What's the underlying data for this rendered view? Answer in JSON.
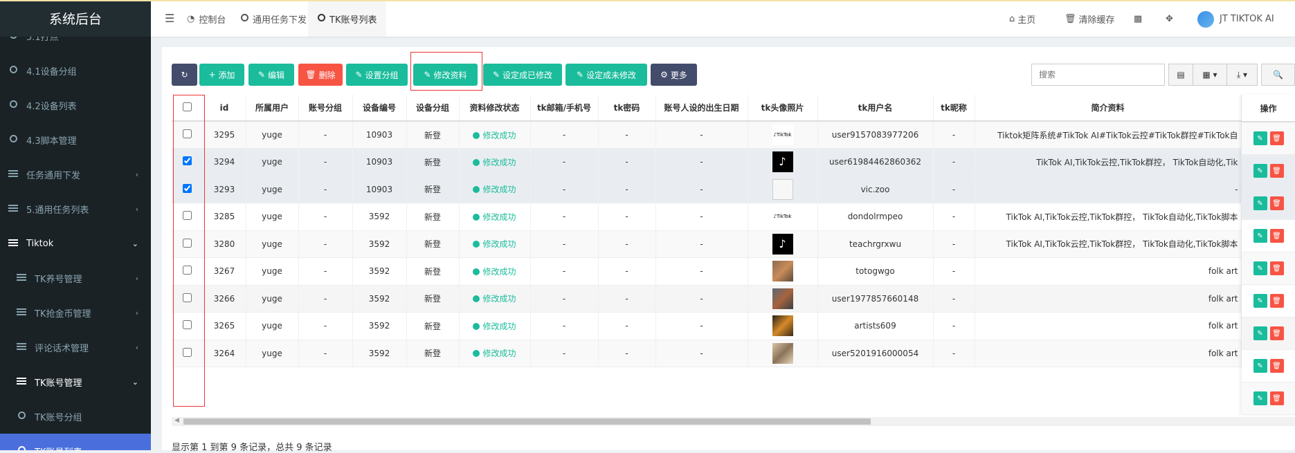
{
  "app_title": "系统后台",
  "sidebar": {
    "items": [
      {
        "label": "5.1打点",
        "icon": "circle",
        "type": "leaf"
      },
      {
        "label": "4.1设备分组",
        "icon": "circle",
        "type": "leaf"
      },
      {
        "label": "4.2设备列表",
        "icon": "circle",
        "type": "leaf"
      },
      {
        "label": "4.3脚本管理",
        "icon": "circle",
        "type": "leaf"
      },
      {
        "label": "任务通用下发",
        "icon": "list",
        "type": "group"
      },
      {
        "label": "5.通用任务列表",
        "icon": "list",
        "type": "group"
      },
      {
        "label": "Tiktok",
        "icon": "list",
        "type": "open"
      },
      {
        "label": "TK养号管理",
        "icon": "list",
        "type": "subgroup"
      },
      {
        "label": "TK抢金币管理",
        "icon": "list",
        "type": "subgroup"
      },
      {
        "label": "评论话术管理",
        "icon": "list",
        "type": "subgroup"
      },
      {
        "label": "TK账号管理",
        "icon": "list",
        "type": "subopen"
      },
      {
        "label": "TK账号分组",
        "icon": "circle",
        "type": "subleaf"
      },
      {
        "label": "TK账号列表",
        "icon": "circle",
        "type": "active"
      }
    ]
  },
  "header": {
    "tabs": [
      {
        "label": "控制台",
        "icon": "dashboard-icon"
      },
      {
        "label": "通用任务下发",
        "icon": "circle-icon"
      },
      {
        "label": "TK账号列表",
        "icon": "circle-icon",
        "active": true
      }
    ],
    "home": "主页",
    "clear_cache": "清除缓存",
    "user": "JT TIKTOK AI"
  },
  "toolbar": {
    "add": "添加",
    "edit": "编辑",
    "delete": "删除",
    "set_group": "设置分组",
    "modify_profile": "修改资料",
    "set_modified": "设定成已修改",
    "set_unmodified": "设定成未修改",
    "more": "更多",
    "search_placeholder": "搜索"
  },
  "colors": {
    "teal": "#1abc9c",
    "red": "#f75444",
    "navy": "#444c6b",
    "sidebar_active": "#4a6fdc"
  },
  "table": {
    "columns": [
      "id",
      "所属用户",
      "账号分组",
      "设备编号",
      "设备分组",
      "资料修改状态",
      "tk邮箱/手机号",
      "tk密码",
      "账号人设的出生日期",
      "tk头像照片",
      "tk用户名",
      "tk昵称",
      "简介资料",
      "操作"
    ],
    "rows": [
      {
        "checked": false,
        "id": "3295",
        "user": "yuge",
        "group": "-",
        "device": "10903",
        "dgroup": "新登",
        "status": "修改成功",
        "email": "-",
        "pwd": "-",
        "birth": "-",
        "avatar": "tiktok-logo-white",
        "username": "user9157083977206",
        "nick": "-",
        "intro": "Tiktok矩阵系统#TikTok AI#TikTok云控#TikTok群控#TikTok自"
      },
      {
        "checked": true,
        "id": "3294",
        "user": "yuge",
        "group": "-",
        "device": "10903",
        "dgroup": "新登",
        "status": "修改成功",
        "email": "-",
        "pwd": "-",
        "birth": "-",
        "avatar": "tiktok-logo-black",
        "username": "user61984462860362",
        "nick": "-",
        "intro": "TikTok AI,TikTok云控,TikTok群控， TikTok自动化,Tik"
      },
      {
        "checked": true,
        "id": "3293",
        "user": "yuge",
        "group": "-",
        "device": "10903",
        "dgroup": "新登",
        "status": "修改成功",
        "email": "-",
        "pwd": "-",
        "birth": "-",
        "avatar": "broken-image",
        "username": "vic.zoo",
        "nick": "-",
        "intro": "-"
      },
      {
        "checked": false,
        "id": "3285",
        "user": "yuge",
        "group": "-",
        "device": "3592",
        "dgroup": "新登",
        "status": "修改成功",
        "email": "-",
        "pwd": "-",
        "birth": "-",
        "avatar": "tiktok-logo-white",
        "username": "dondolrmpeo",
        "nick": "-",
        "intro": "TikTok AI,TikTok云控,TikTok群控， TikTok自动化,TikTok脚本"
      },
      {
        "checked": false,
        "id": "3280",
        "user": "yuge",
        "group": "-",
        "device": "3592",
        "dgroup": "新登",
        "status": "修改成功",
        "email": "-",
        "pwd": "-",
        "birth": "-",
        "avatar": "tiktok-logo-black",
        "username": "teachrgrxwu",
        "nick": "-",
        "intro": "TikTok AI,TikTok云控,TikTok群控， TikTok自动化,TikTok脚本"
      },
      {
        "checked": false,
        "id": "3267",
        "user": "yuge",
        "group": "-",
        "device": "3592",
        "dgroup": "新登",
        "status": "修改成功",
        "email": "-",
        "pwd": "-",
        "birth": "-",
        "avatar": "photo-sculpture",
        "username": "totogwgo",
        "nick": "-",
        "intro": "folk art"
      },
      {
        "checked": false,
        "id": "3266",
        "user": "yuge",
        "group": "-",
        "device": "3592",
        "dgroup": "新登",
        "status": "修改成功",
        "email": "-",
        "pwd": "-",
        "birth": "-",
        "avatar": "photo-carving",
        "username": "user1977857660148",
        "nick": "-",
        "intro": "folk art"
      },
      {
        "checked": false,
        "id": "3265",
        "user": "yuge",
        "group": "-",
        "device": "3592",
        "dgroup": "新登",
        "status": "修改成功",
        "email": "-",
        "pwd": "-",
        "birth": "-",
        "avatar": "photo-wood",
        "username": "artists609",
        "nick": "-",
        "intro": "folk art"
      },
      {
        "checked": false,
        "id": "3264",
        "user": "yuge",
        "group": "-",
        "device": "3592",
        "dgroup": "新登",
        "status": "修改成功",
        "email": "-",
        "pwd": "-",
        "birth": "-",
        "avatar": "photo-painting",
        "username": "user5201916000054",
        "nick": "-",
        "intro": "folk art"
      }
    ]
  },
  "footer": "显示第 1 到第 9 条记录，总共 9 条记录"
}
